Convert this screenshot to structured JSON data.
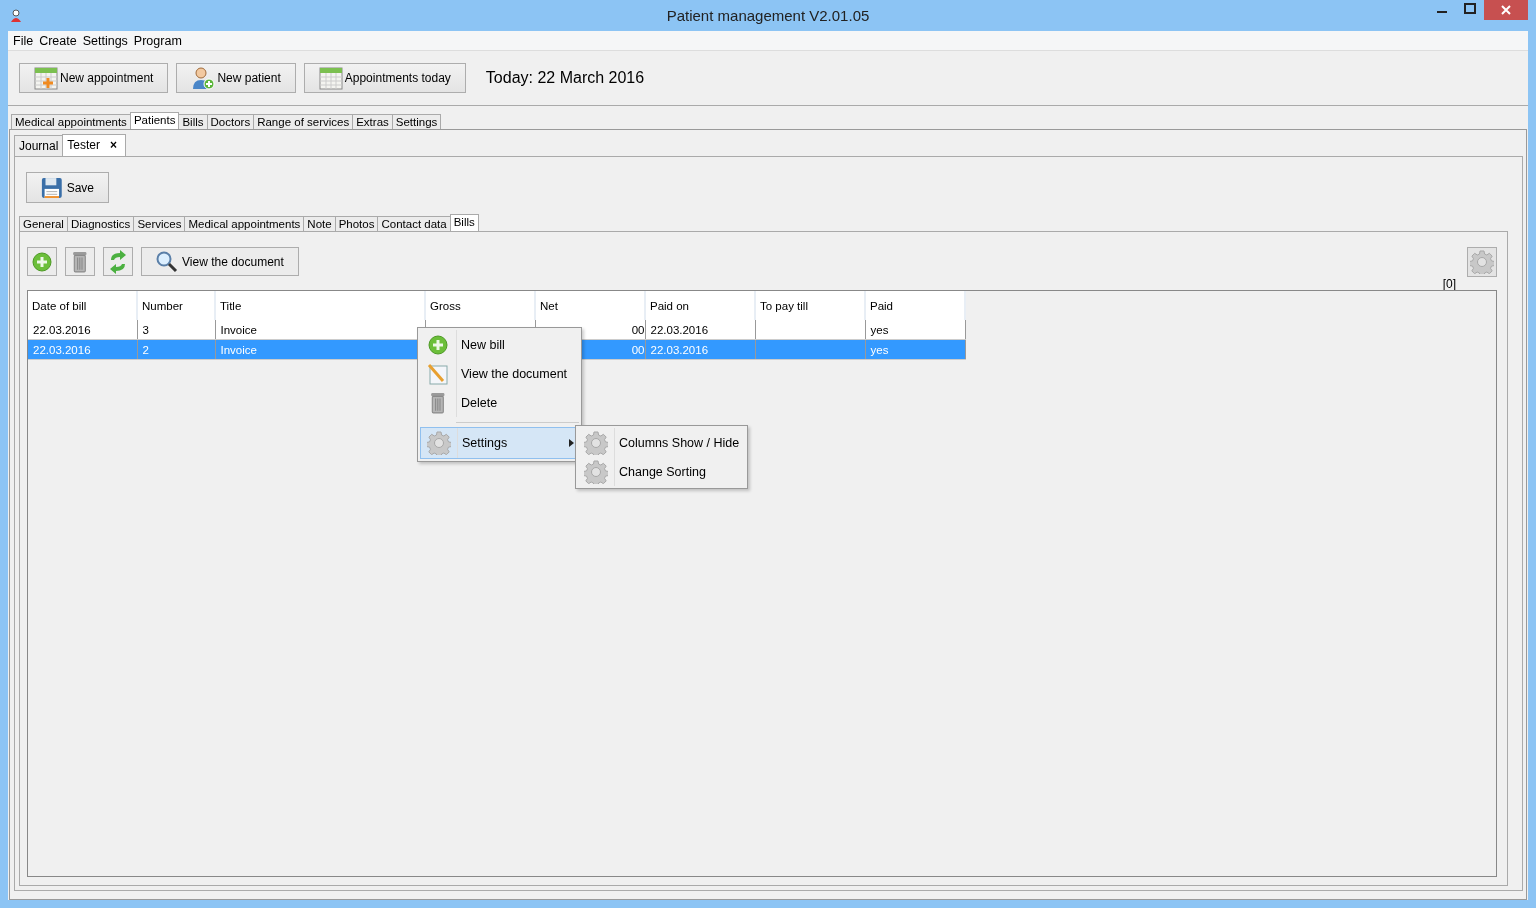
{
  "window": {
    "title": "Patient management V2.01.05"
  },
  "menu_bar": [
    "File",
    "Create",
    "Settings",
    "Program"
  ],
  "toolbar": {
    "buttons": [
      "New appointment",
      "New patient",
      "Appointments today"
    ],
    "today": "Today: 22 March 2016"
  },
  "main_tabs": [
    {
      "label": "Medical appointments",
      "selected": false
    },
    {
      "label": "Patients",
      "selected": true
    },
    {
      "label": "Bills",
      "selected": false
    },
    {
      "label": "Doctors",
      "selected": false
    },
    {
      "label": "Range of services",
      "selected": false
    },
    {
      "label": "Extras",
      "selected": false
    },
    {
      "label": "Settings",
      "selected": false
    }
  ],
  "patient_tabs": [
    {
      "label": "Journal",
      "selected": false
    },
    {
      "label": "Tester",
      "selected": true,
      "close": "×"
    }
  ],
  "save_button": "Save",
  "detail_tabs": [
    {
      "label": "General",
      "selected": false
    },
    {
      "label": "Diagnostics",
      "selected": false
    },
    {
      "label": "Services",
      "selected": false
    },
    {
      "label": "Medical appointments",
      "selected": false
    },
    {
      "label": "Note",
      "selected": false
    },
    {
      "label": "Photos",
      "selected": false
    },
    {
      "label": "Contact data",
      "selected": false
    },
    {
      "label": "Bills",
      "selected": true
    }
  ],
  "bills_toolbar": {
    "view_button": "View the document",
    "count": "[0]"
  },
  "table": {
    "columns": [
      "Date of bill",
      "Number",
      "Title",
      "Gross",
      "Net",
      "Paid on",
      "To pay till",
      "Paid"
    ],
    "rows": [
      {
        "selected": false,
        "cells": [
          "22.03.2016",
          "3",
          "Invoice",
          "",
          "00",
          "22.03.2016",
          "",
          "yes"
        ]
      },
      {
        "selected": true,
        "cells": [
          "22.03.2016",
          "2",
          "Invoice",
          "",
          "00",
          "22.03.2016",
          "",
          "yes"
        ]
      }
    ]
  },
  "context_menu": {
    "items": [
      {
        "label": "New bill",
        "selected": false,
        "kind": "item"
      },
      {
        "label": "View the document",
        "selected": false,
        "kind": "item"
      },
      {
        "label": "Delete",
        "selected": false,
        "kind": "item"
      },
      {
        "label": "Settings",
        "selected": true,
        "kind": "submenu"
      }
    ],
    "submenu": [
      "Columns Show / Hide",
      "Change Sorting"
    ]
  }
}
